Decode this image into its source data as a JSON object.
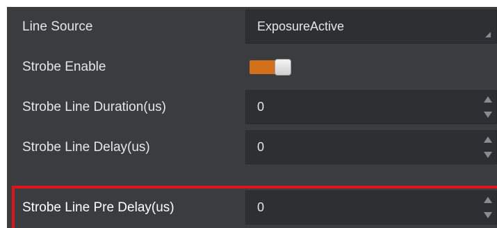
{
  "properties": [
    {
      "label": "Line Source",
      "type": "dropdown",
      "value": "ExposureActive"
    },
    {
      "label": "Strobe Enable",
      "type": "toggle",
      "on": true
    },
    {
      "label": "Strobe Line Duration(us)",
      "type": "spinbox",
      "value": "0"
    },
    {
      "label": "Strobe Line Delay(us)",
      "type": "spinbox",
      "value": "0"
    },
    {
      "label": "Strobe Line Pre Delay(us)",
      "type": "spinbox",
      "value": "0",
      "highlighted": true
    }
  ],
  "colors": {
    "panel_background": "#3b3c40",
    "field_background": "#2e2f33",
    "toggle_on": "#d2701c",
    "highlight_border": "#e0141a"
  }
}
